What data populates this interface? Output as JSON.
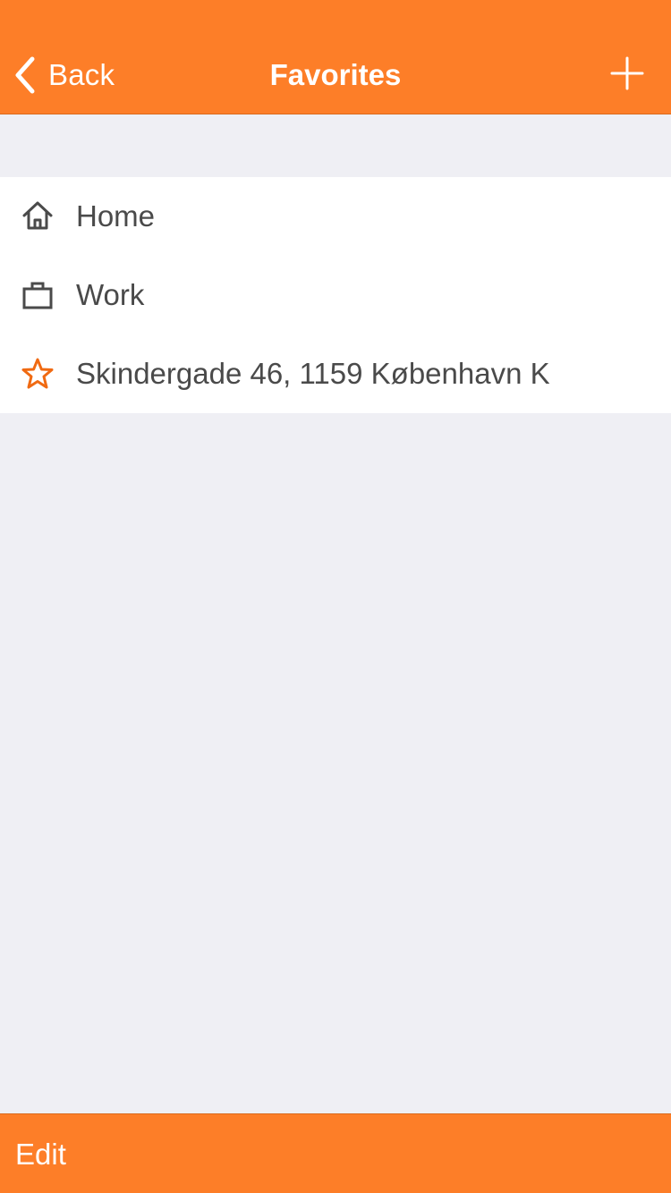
{
  "navbar": {
    "back_label": "Back",
    "title": "Favorites",
    "add_icon": "plus-icon",
    "back_icon": "chevron-left-icon"
  },
  "favorites": [
    {
      "label": "Home",
      "icon": "home-icon"
    },
    {
      "label": "Work",
      "icon": "briefcase-icon"
    },
    {
      "label": "Skindergade 46, 1159 København K",
      "icon": "star-icon"
    }
  ],
  "toolbar": {
    "edit_label": "Edit"
  },
  "colors": {
    "accent": "#fd7e28",
    "background": "#efeff4",
    "row_background": "#ffffff",
    "text": "#4a4a4a",
    "icon_gray": "#4a4a4a",
    "star": "#f06a12"
  }
}
